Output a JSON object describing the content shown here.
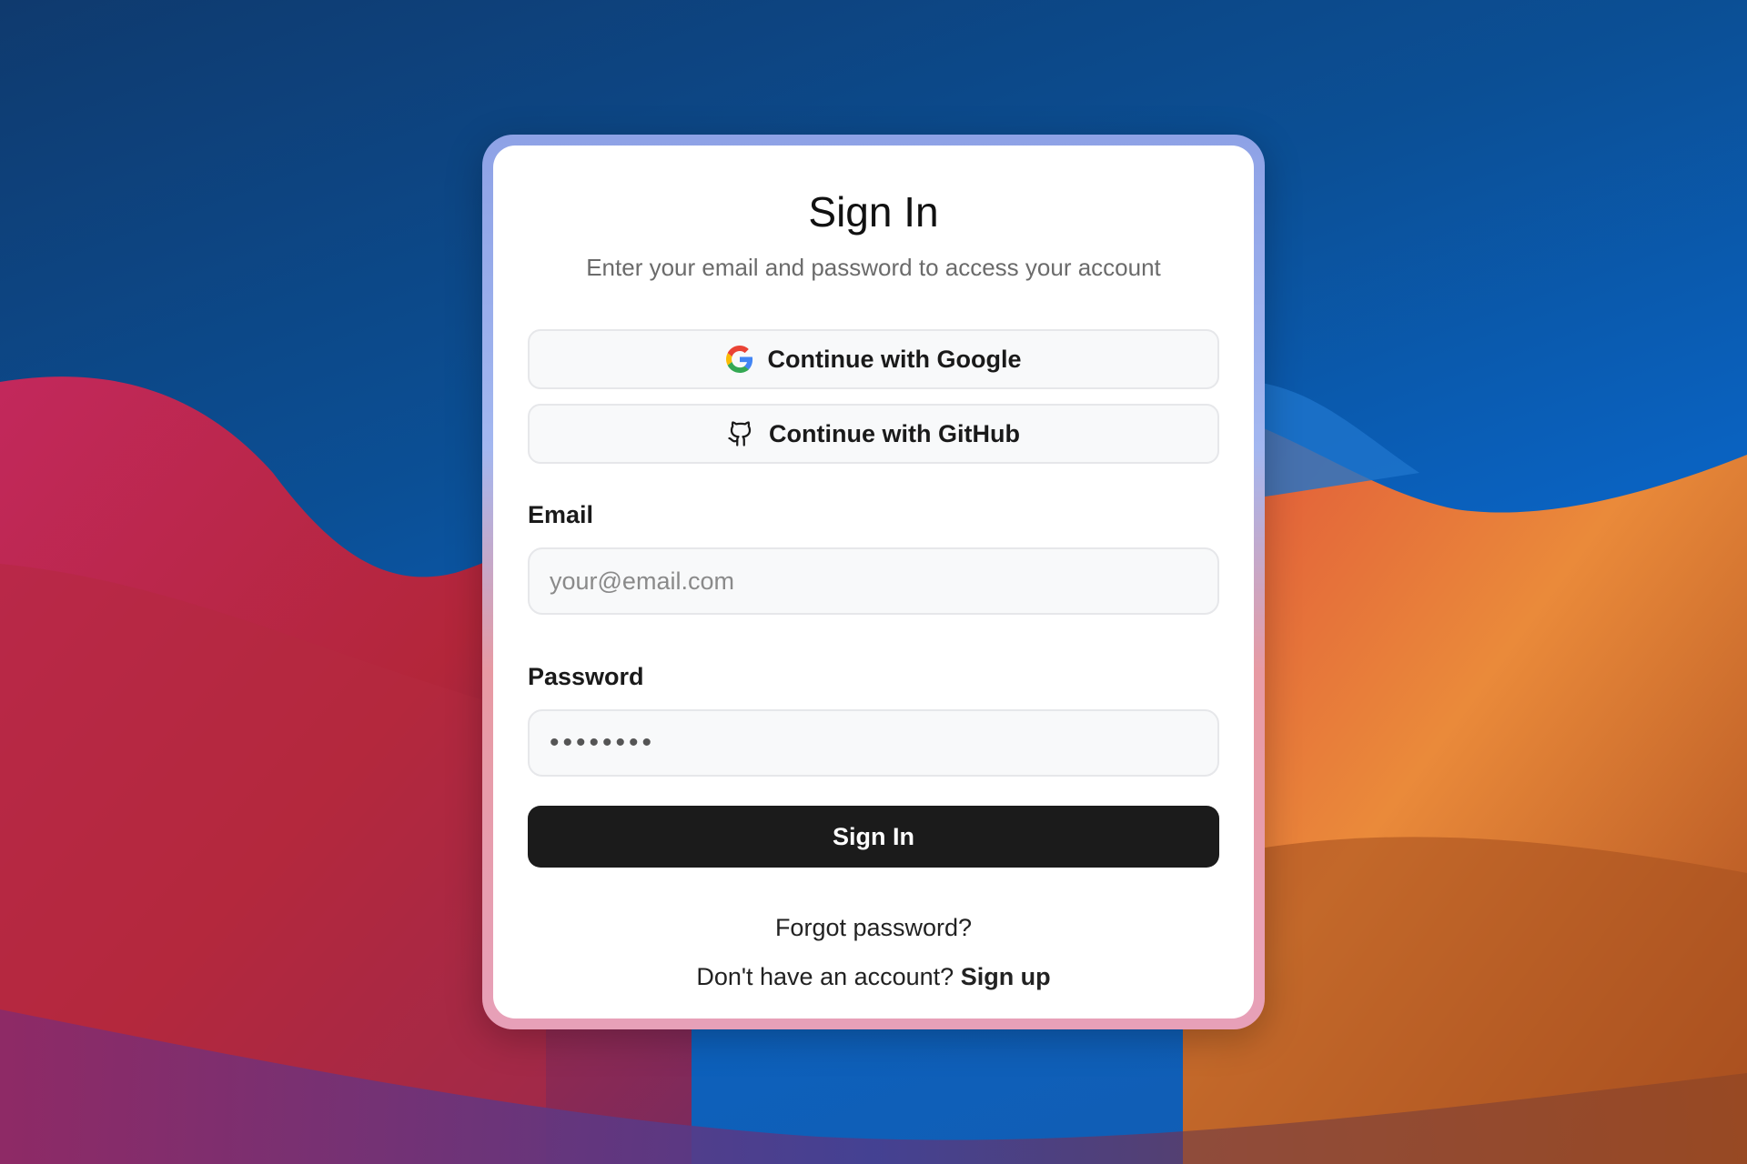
{
  "signin": {
    "title": "Sign In",
    "subtitle": "Enter your email and password to access your account",
    "google_button": "Continue with Google",
    "github_button": "Continue with GitHub",
    "email_label": "Email",
    "email_placeholder": "your@email.com",
    "email_value": "",
    "password_label": "Password",
    "password_value": "••••••••",
    "submit_button": "Sign In",
    "forgot_link": "Forgot password?",
    "signup_prompt": "Don't have an account? ",
    "signup_link": "Sign up"
  },
  "icons": {
    "google": "google-icon",
    "github": "github-icon"
  },
  "colors": {
    "primary_button": "#1b1b1b",
    "card": "#ffffff",
    "card_border_top": "#8ea2e6",
    "card_border_bottom": "#e79aa3"
  }
}
